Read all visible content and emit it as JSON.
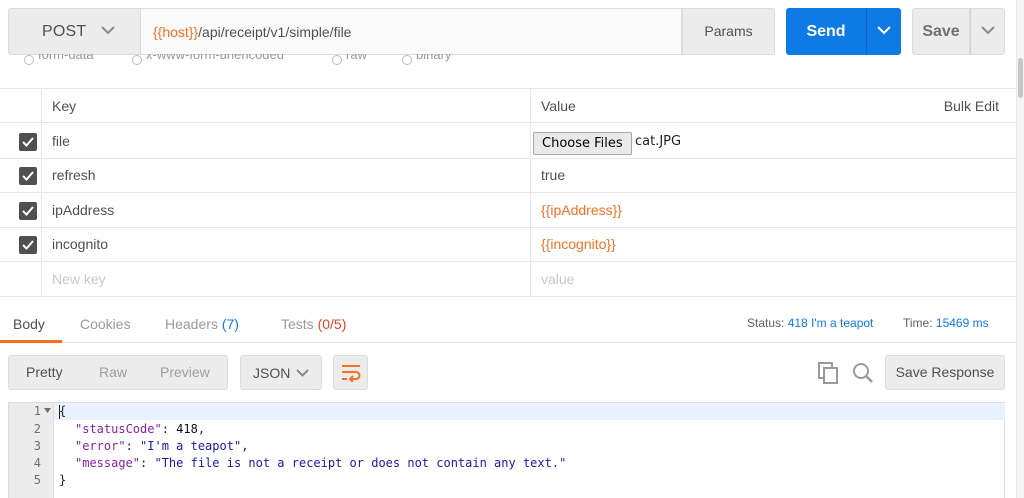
{
  "request": {
    "method": "POST",
    "url_var": "{{host}}",
    "url_path": "/api/receipt/v1/simple/file",
    "params_label": "Params",
    "send_label": "Send",
    "save_label": "Save"
  },
  "body_types": [
    "form-data",
    "x-www-form-urlencoded",
    "raw",
    "binary"
  ],
  "table": {
    "header_key": "Key",
    "header_value": "Value",
    "bulk_edit": "Bulk Edit",
    "rows": [
      {
        "key": "file",
        "value_button": "Choose Files",
        "value_file": "cat.JPG",
        "checked": true
      },
      {
        "key": "refresh",
        "value": "true",
        "checked": true
      },
      {
        "key": "ipAddress",
        "value": "{{ipAddress}}",
        "checked": true
      },
      {
        "key": "incognito",
        "value": "{{incognito}}",
        "checked": true
      }
    ],
    "new_key_placeholder": "New key",
    "new_value_placeholder": "value"
  },
  "response": {
    "tabs": [
      {
        "label": "Body"
      },
      {
        "label": "Cookies"
      },
      {
        "label": "Headers",
        "count": "(7)"
      },
      {
        "label": "Tests",
        "count": "(0/5)"
      }
    ],
    "status_label": "Status:",
    "status_value": "418 I'm a teapot",
    "time_label": "Time:",
    "time_value": "15469 ms",
    "view_modes": [
      "Pretty",
      "Raw",
      "Preview"
    ],
    "format": "JSON",
    "save_response": "Save Response",
    "code": {
      "line_numbers": [
        "1",
        "2",
        "3",
        "4",
        "5"
      ],
      "open_brace": "{",
      "close_brace": "}",
      "key1": "\"statusCode\"",
      "val1": "418",
      "key2": "\"error\"",
      "val2": "\"I'm a teapot\"",
      "key3": "\"message\"",
      "val3": "\"The file is not a receipt or does not contain any text.\""
    }
  },
  "colors": {
    "accent": "#f47023",
    "send_blue": "#0e7ae6",
    "error_red": "#e0442b"
  },
  "icons": [
    "chevron-down-icon",
    "checkbox-icon",
    "wrap-lines-icon",
    "copy-icon",
    "search-icon",
    "fold-arrow-icon"
  ]
}
